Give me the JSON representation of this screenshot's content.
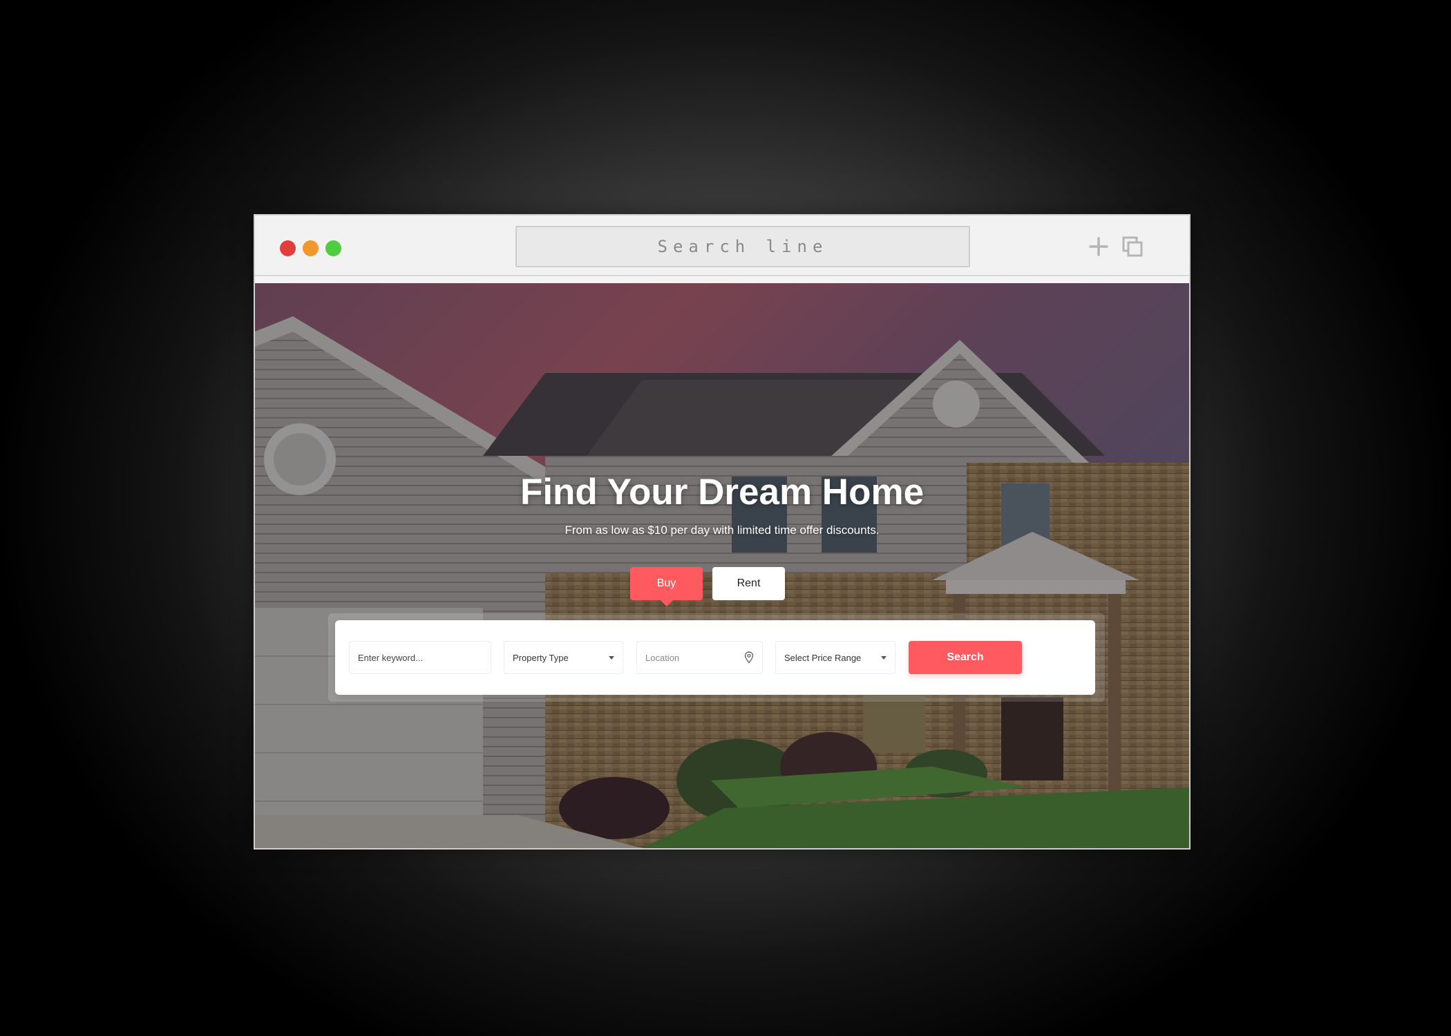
{
  "browser": {
    "address_placeholder": "Search line",
    "icons": [
      "plus-icon",
      "copy-icon"
    ],
    "traffic_colors": [
      "#e23d3d",
      "#f2972b",
      "#4fcc3f"
    ]
  },
  "hero": {
    "title": "Find Your Dream Home",
    "subtitle": "From as low as $10 per day with limited time offer discounts.",
    "background_image": "house-photo"
  },
  "tabs": [
    {
      "label": "Buy",
      "active": true
    },
    {
      "label": "Rent",
      "active": false
    }
  ],
  "search": {
    "keyword_placeholder": "Enter keyword...",
    "property_type": "Property Type",
    "location_placeholder": "Location",
    "price_range": "Select Price Range",
    "button_label": "Search"
  },
  "colors": {
    "accent": "#ff5a5f",
    "white": "#ffffff"
  }
}
